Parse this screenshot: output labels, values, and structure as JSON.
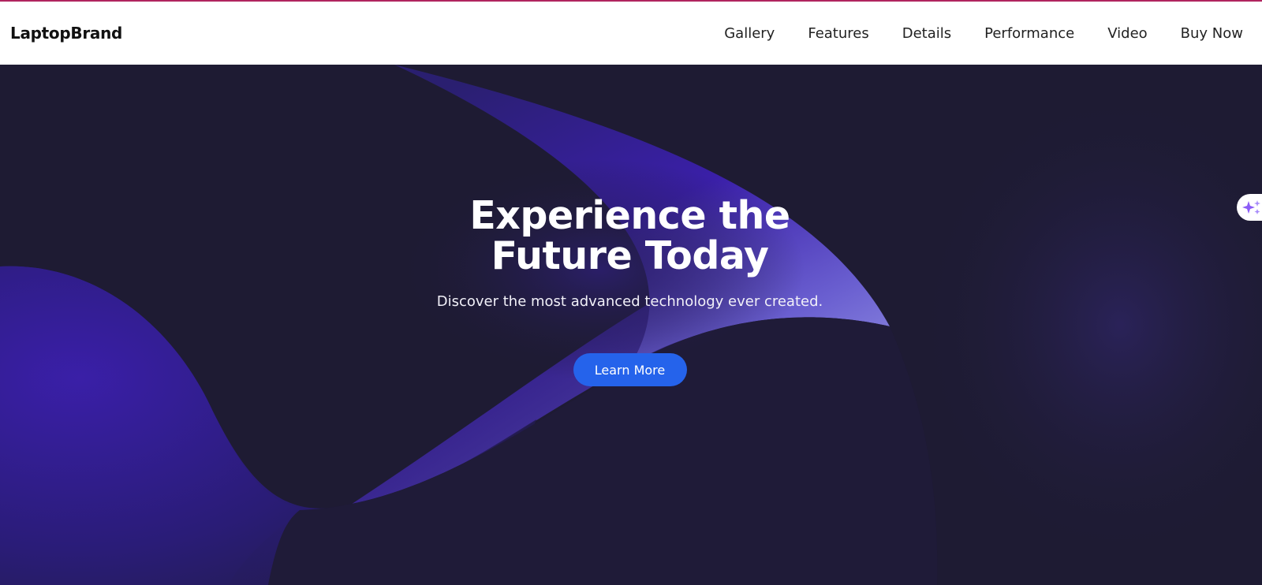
{
  "navbar": {
    "brand": "LaptopBrand",
    "links": [
      "Gallery",
      "Features",
      "Details",
      "Performance",
      "Video",
      "Buy Now"
    ]
  },
  "hero": {
    "title": "Experience the Future Today",
    "subtitle": "Discover the most advanced technology ever created.",
    "cta_label": "Learn More"
  },
  "side_widget": {
    "icon": "sparkles-icon"
  },
  "colors": {
    "accent_bar": "#b0245f",
    "hero_bg": "#1e1b33",
    "wave_purple": "#3a1fa8",
    "cta_blue": "#2563eb",
    "sparkle": "#8b5cf6"
  }
}
